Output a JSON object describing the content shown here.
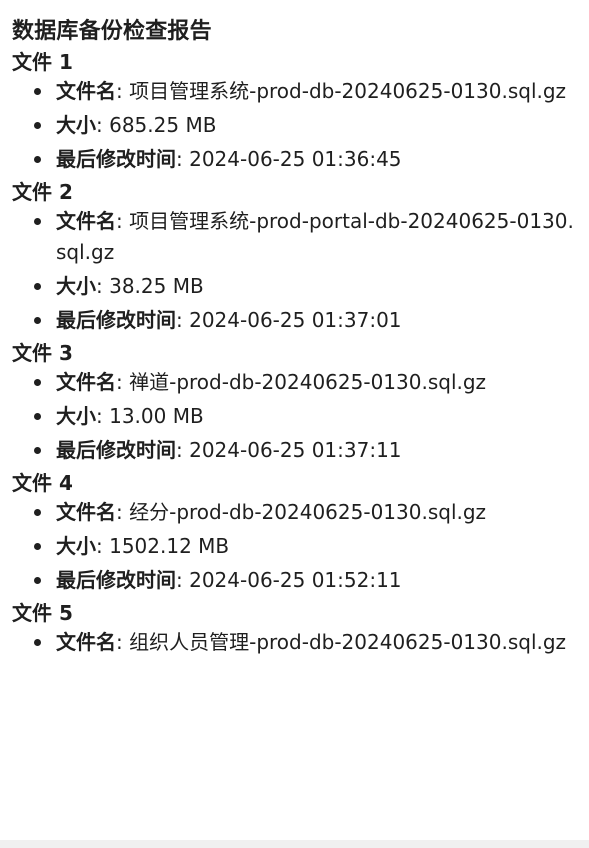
{
  "report": {
    "title": "数据库备份检查报告",
    "labels": {
      "name": "文件名",
      "size": "大小",
      "mtime": "最后修改时间",
      "separator": ": "
    },
    "files": [
      {
        "heading": "文件 1",
        "name": "项目管理系统-prod-db-20240625-0130.sql.gz",
        "size": "685.25 MB",
        "mtime": "2024-06-25 01:36:45"
      },
      {
        "heading": "文件 2",
        "name": "项目管理系统-prod-portal-db-20240625-0130.sql.gz",
        "size": "38.25 MB",
        "mtime": "2024-06-25 01:37:01"
      },
      {
        "heading": "文件 3",
        "name": "禅道-prod-db-20240625-0130.sql.gz",
        "size": "13.00 MB",
        "mtime": "2024-06-25 01:37:11"
      },
      {
        "heading": "文件 4",
        "name": "经分-prod-db-20240625-0130.sql.gz",
        "size": "1502.12 MB",
        "mtime": "2024-06-25 01:52:11"
      },
      {
        "heading": "文件 5",
        "name": "组织人员管理-prod-db-20240625-0130.sql.gz"
      }
    ]
  }
}
